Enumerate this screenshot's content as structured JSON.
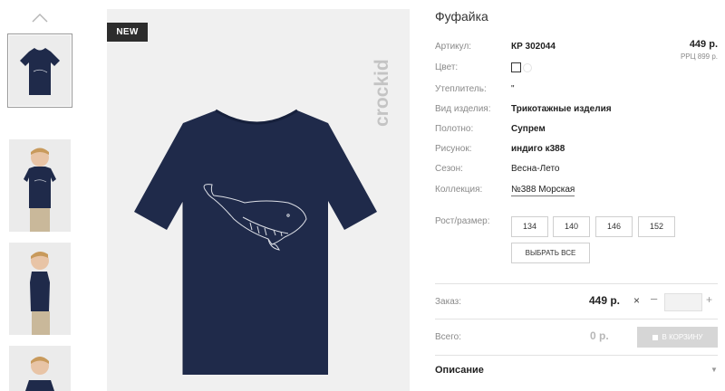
{
  "gallery": {
    "badge": "NEW",
    "brand_logo_text": "crockid"
  },
  "product": {
    "title": "Фуфайка",
    "price": "449 р.",
    "rrp": "РРЦ 899 р."
  },
  "attributes": [
    {
      "label": "Артикул:",
      "value": "КР 302044"
    },
    {
      "label": "Цвет:",
      "value": ""
    },
    {
      "label": "Утеплитель:",
      "value": "\""
    },
    {
      "label": "Вид изделия:",
      "value": "Трикотажные изделия"
    },
    {
      "label": "Полотно:",
      "value": "Супрем"
    },
    {
      "label": "Рисунок:",
      "value": "индиго к388"
    },
    {
      "label": "Сезон:",
      "value": "Весна-Лето"
    },
    {
      "label": "Коллекция:",
      "value": "№388 Морская"
    }
  ],
  "sizes": {
    "label": "Рост/размер:",
    "options": [
      "134",
      "140",
      "146",
      "152"
    ],
    "select_all": "ВЫБРАТЬ ВСЕ"
  },
  "order": {
    "label": "Заказ:",
    "price": "449 р.",
    "times": "×",
    "minus": "–",
    "plus": "+",
    "quantity": ""
  },
  "total": {
    "label": "Всего:",
    "value": "0 р.",
    "cart_button": "В КОРЗИНУ"
  },
  "description": {
    "label": "Описание"
  },
  "colors": {
    "tshirt": "#1f2a4a",
    "badge_bg": "#2d2d2d",
    "button_disabled": "#d6d6d6"
  }
}
